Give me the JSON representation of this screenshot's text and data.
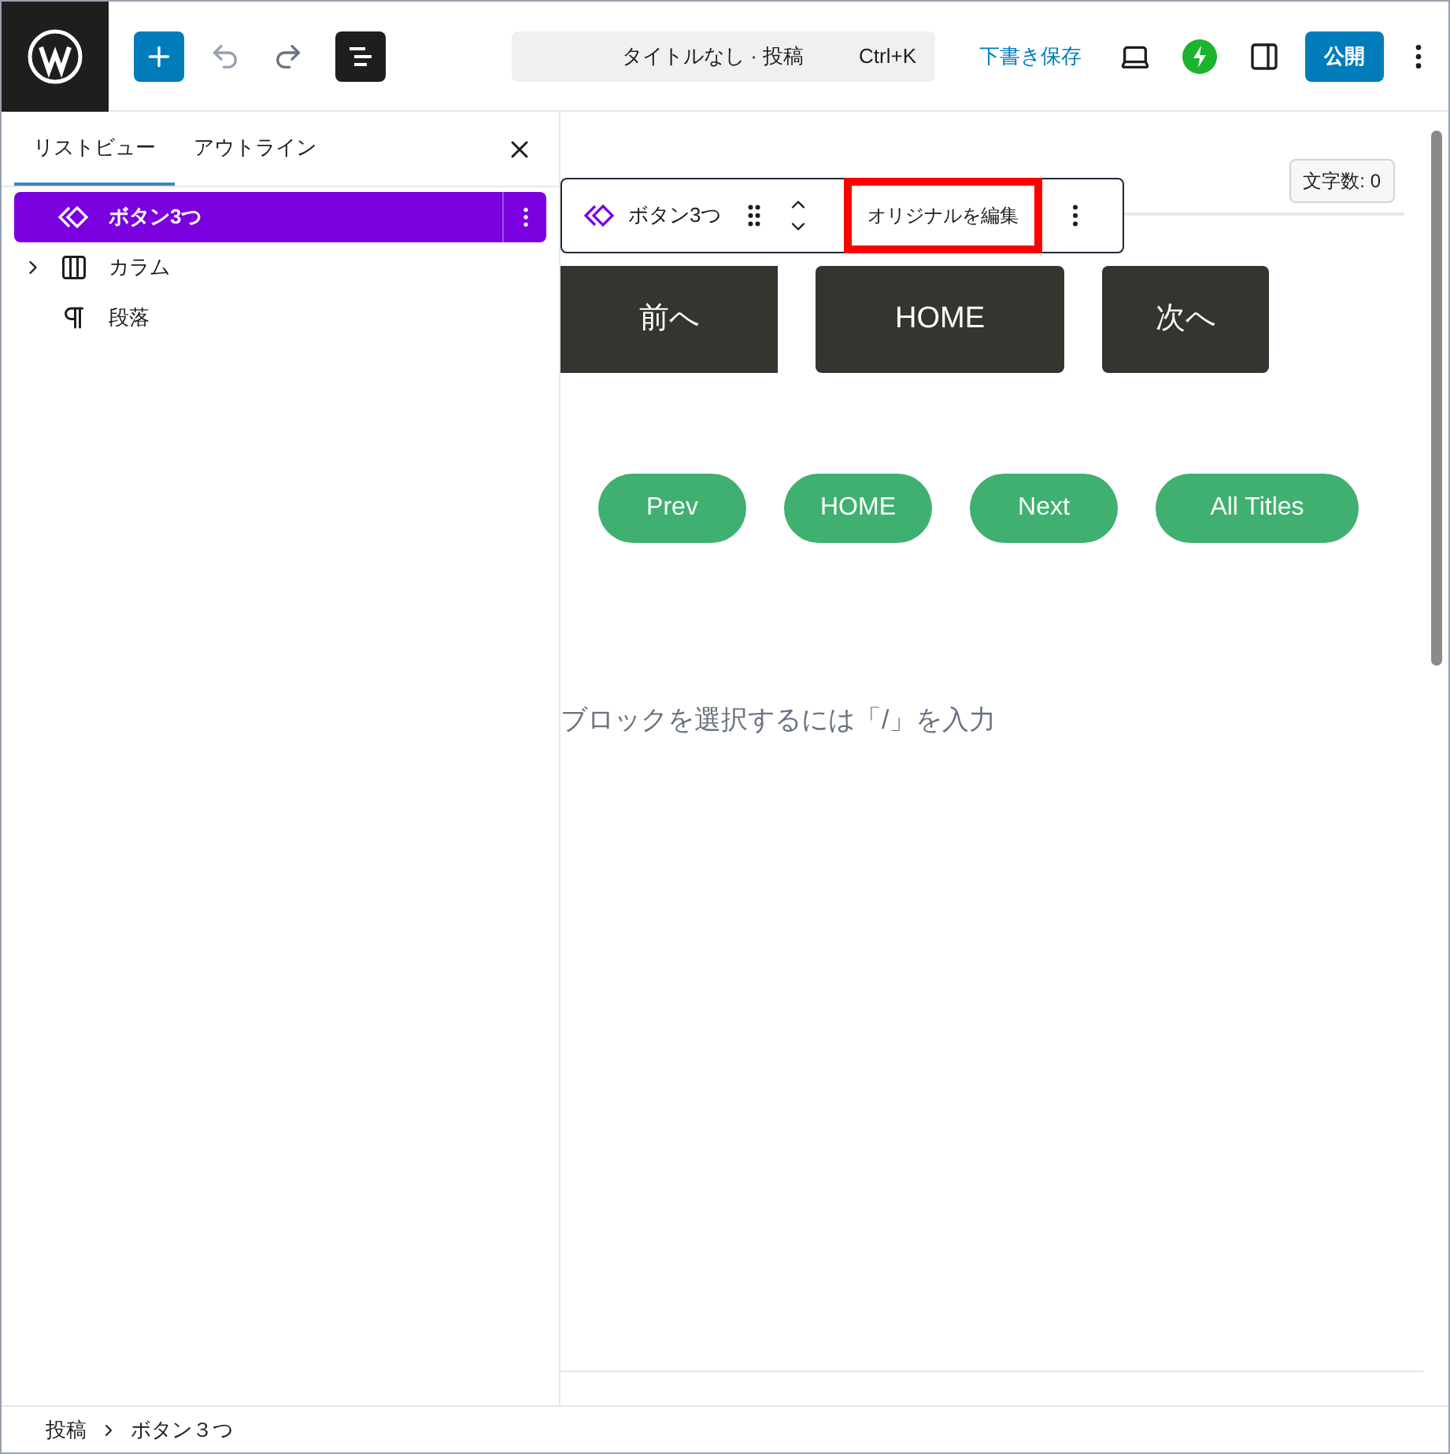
{
  "topbar": {
    "search": "タイトルなし · 投稿",
    "shortcut": "Ctrl+K",
    "save_draft": "下書き保存",
    "publish": "公開"
  },
  "sidebar": {
    "tabs": [
      {
        "label": "リストビュー",
        "selected": true
      },
      {
        "label": "アウトライン",
        "selected": false
      }
    ],
    "items": [
      {
        "kind": "pattern",
        "label": "ボタン3つ",
        "selected": true,
        "has_children": false
      },
      {
        "kind": "columns",
        "label": "カラム",
        "selected": false,
        "has_children": true
      },
      {
        "kind": "paragraph",
        "label": "段落",
        "selected": false,
        "has_children": false
      }
    ]
  },
  "editor": {
    "char_count": "文字数: 0",
    "block_toolbar": {
      "block_name": "ボタン3つ",
      "edit_original": "オリジナルを編集"
    },
    "dark_buttons": [
      "前へ",
      "HOME",
      "次へ"
    ],
    "green_buttons": [
      "Prev",
      "HOME",
      "Next",
      "All Titles"
    ],
    "append_hint": "ブロックを選択するには「/」を入力"
  },
  "breadcrumb": [
    "投稿",
    "ボタン３つ"
  ]
}
